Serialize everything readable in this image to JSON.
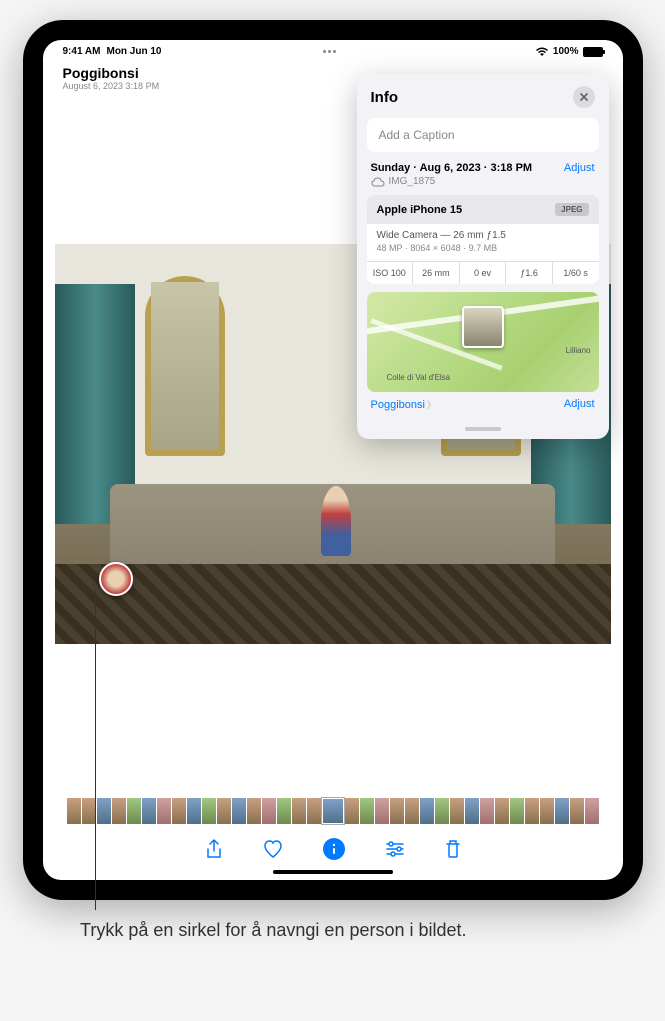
{
  "status_bar": {
    "time": "9:41 AM",
    "date": "Mon Jun 10",
    "battery": "100%"
  },
  "header": {
    "location": "Poggibonsi",
    "subtitle": "August 6, 2023  3:18 PM"
  },
  "info_panel": {
    "title": "Info",
    "caption_placeholder": "Add a Caption",
    "datetime": "Sunday · Aug 6, 2023 · 3:18 PM",
    "filename": "IMG_1875",
    "adjust_label": "Adjust",
    "camera": {
      "device": "Apple iPhone 15",
      "format": "JPEG",
      "lens": "Wide Camera — 26 mm ƒ1.5",
      "specs": "48 MP · 8064 × 6048 · 9.7 MB",
      "exif": {
        "iso": "ISO 100",
        "focal": "26 mm",
        "ev": "0 ev",
        "aperture": "ƒ1.6",
        "shutter": "1/60 s"
      }
    },
    "map": {
      "place": "Poggibonsi",
      "label1": "Colle di Val d'Elsa",
      "label2": "Lilliano",
      "adjust_label": "Adjust"
    }
  },
  "caption": "Trykk på en sirkel for å navngi en person i bildet."
}
